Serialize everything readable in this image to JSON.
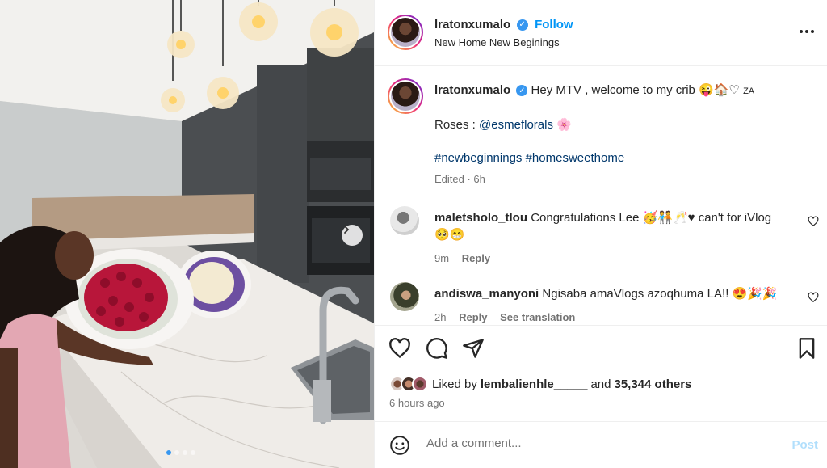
{
  "post": {
    "username": "lratonxumalo",
    "follow_label": "Follow",
    "location": "New Home New Beginings",
    "more_label": "..."
  },
  "caption": {
    "username": "lratonxumalo",
    "text": "Hey MTV , welcome to my crib",
    "emojis": "😜🏠♡",
    "flag": "ZA",
    "roses_label": "Roses :",
    "roses_tag": "@esmeflorals",
    "roses_emoji": "🌸",
    "hashtags": "#newbeginnings #homesweethome",
    "edited": "Edited · 6h"
  },
  "comments": [
    {
      "username": "maletsholo_tlou",
      "text": "Congratulations Lee 🥳🧑‍🤝‍🧑🥂♥ can't for iVlog",
      "text_line2": "🥺😁",
      "time": "9m",
      "reply": "Reply"
    },
    {
      "username": "andiswa_manyoni",
      "text": "Ngisaba amaVlogs azoqhuma LA!! 😍🎉🎉",
      "time": "2h",
      "reply": "Reply",
      "translate": "See translation"
    }
  ],
  "likes": {
    "prefix": "Liked by",
    "user": "lembalienhle_____",
    "middle": "and",
    "count": "35,344 others"
  },
  "time_ago": "6 hours ago",
  "add_comment": {
    "placeholder": "Add a comment...",
    "post_label": "Post"
  },
  "carousel": {
    "total": 4,
    "active_index": 0
  },
  "colors": {
    "accent": "#0095f6",
    "verified": "#3797f0",
    "post_disabled": "#b2dffc"
  },
  "icons": [
    "more-icon",
    "verified-icon",
    "heart-icon",
    "comment-icon",
    "share-icon",
    "bookmark-icon",
    "emoji-icon",
    "chevron-right-icon"
  ]
}
